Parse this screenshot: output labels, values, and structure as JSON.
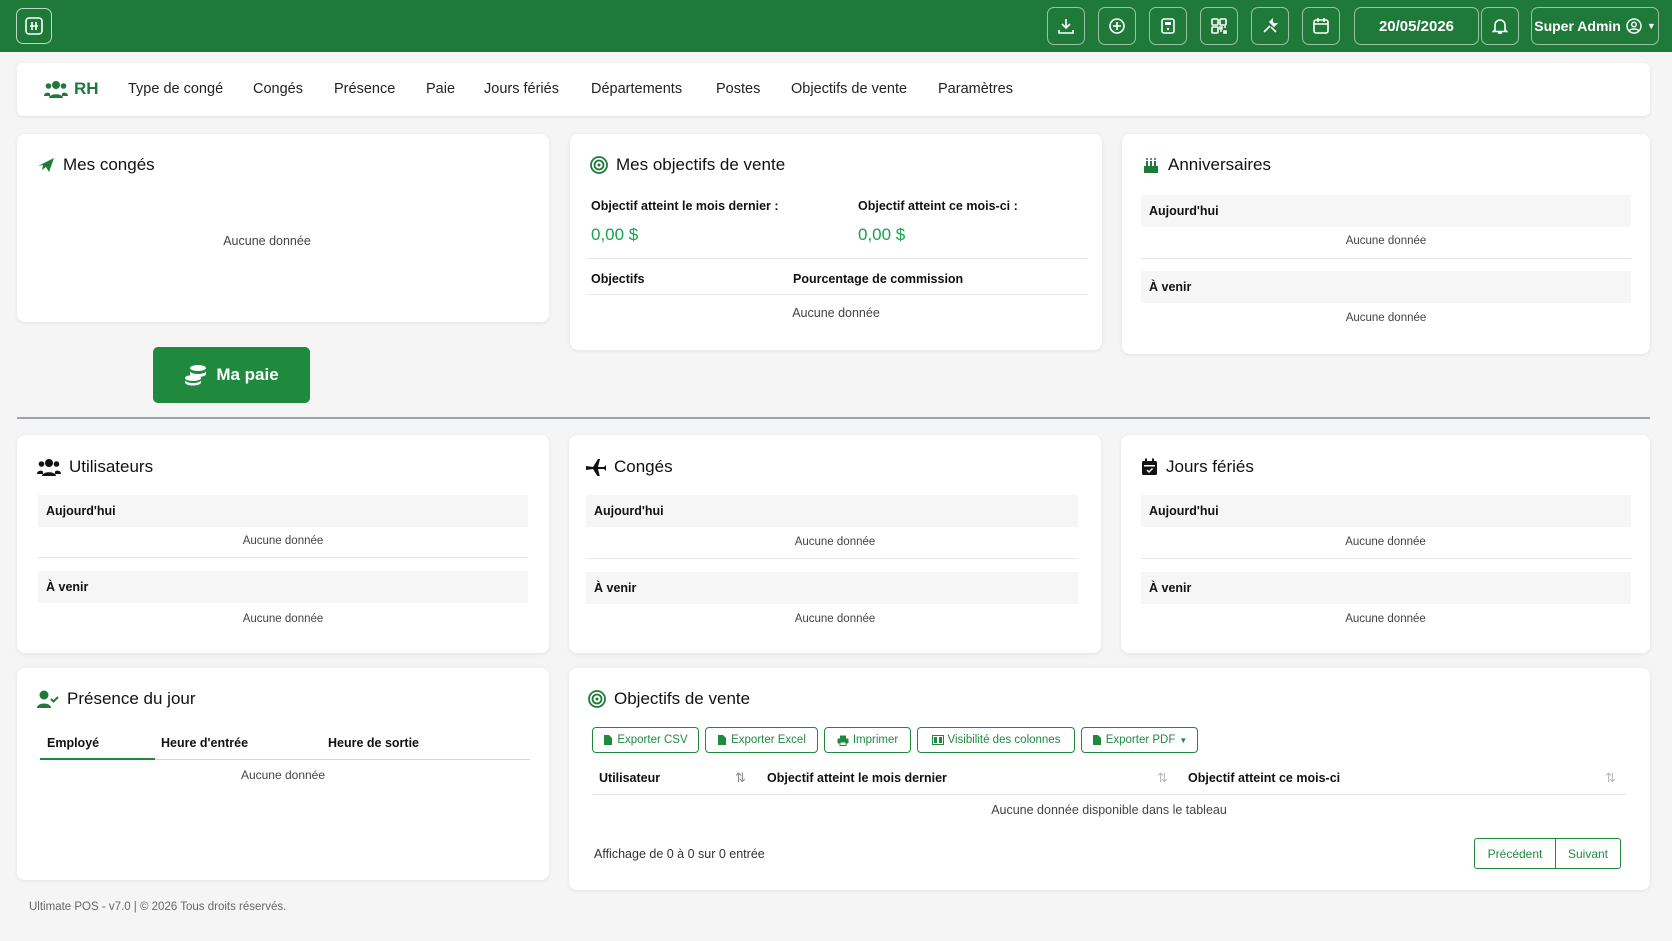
{
  "topbar": {
    "date": "20/05/2026",
    "user": "Super Admin",
    "icons": [
      "download-icon",
      "add-circle-icon",
      "calculator-icon",
      "grid-icon",
      "tools-icon",
      "calendar-icon",
      "bell-icon"
    ],
    "color": "#1f7a3a"
  },
  "nav": {
    "brand": "RH",
    "items": [
      "Type de congé",
      "Congés",
      "Présence",
      "Paie",
      "Jours fériés",
      "Départements",
      "Postes",
      "Objectifs de vente",
      "Paramètres"
    ]
  },
  "my_leaves": {
    "title": "Mes congés",
    "empty": "Aucune donnée"
  },
  "my_sales": {
    "title": "Mes objectifs de vente",
    "last_month_label": "Objectif atteint le mois dernier :",
    "last_month_value": "0,00 $",
    "this_month_label": "Objectif atteint ce mois-ci :",
    "this_month_value": "0,00 $",
    "col_targets": "Objectifs",
    "col_commission": "Pourcentage de commission",
    "empty": "Aucune donnée"
  },
  "birthdays": {
    "title": "Anniversaires",
    "today": "Aujourd'hui",
    "today_empty": "Aucune donnée",
    "upcoming": "À venir",
    "upcoming_empty": "Aucune donnée"
  },
  "payslip_button": "Ma paie",
  "users": {
    "title": "Utilisateurs",
    "today": "Aujourd'hui",
    "today_empty": "Aucune donnée",
    "upcoming": "À venir",
    "upcoming_empty": "Aucune donnée"
  },
  "leaves": {
    "title": "Congés",
    "today": "Aujourd'hui",
    "today_empty": "Aucune donnée",
    "upcoming": "À venir",
    "upcoming_empty": "Aucune donnée"
  },
  "holidays": {
    "title": "Jours fériés",
    "today": "Aujourd'hui",
    "today_empty": "Aucune donnée",
    "upcoming": "À venir",
    "upcoming_empty": "Aucune donnée"
  },
  "attendance": {
    "title": "Présence du jour",
    "col_employee": "Employé",
    "col_in": "Heure d'entrée",
    "col_out": "Heure de sortie",
    "empty": "Aucune donnée"
  },
  "sales_targets": {
    "title": "Objectifs de vente",
    "buttons": {
      "csv": "Exporter CSV",
      "excel": "Exporter Excel",
      "print": "Imprimer",
      "columns": "Visibilité des colonnes",
      "pdf": "Exporter PDF"
    },
    "col_user": "Utilisateur",
    "col_last": "Objectif atteint le mois dernier",
    "col_this": "Objectif atteint ce mois-ci",
    "empty": "Aucune donnée disponible dans le tableau",
    "info": "Affichage de 0 à 0 sur 0 entrée",
    "prev": "Précédent",
    "next": "Suivant"
  },
  "footer": "Ultimate POS - v7.0  |  © 2026 Tous droits réservés."
}
